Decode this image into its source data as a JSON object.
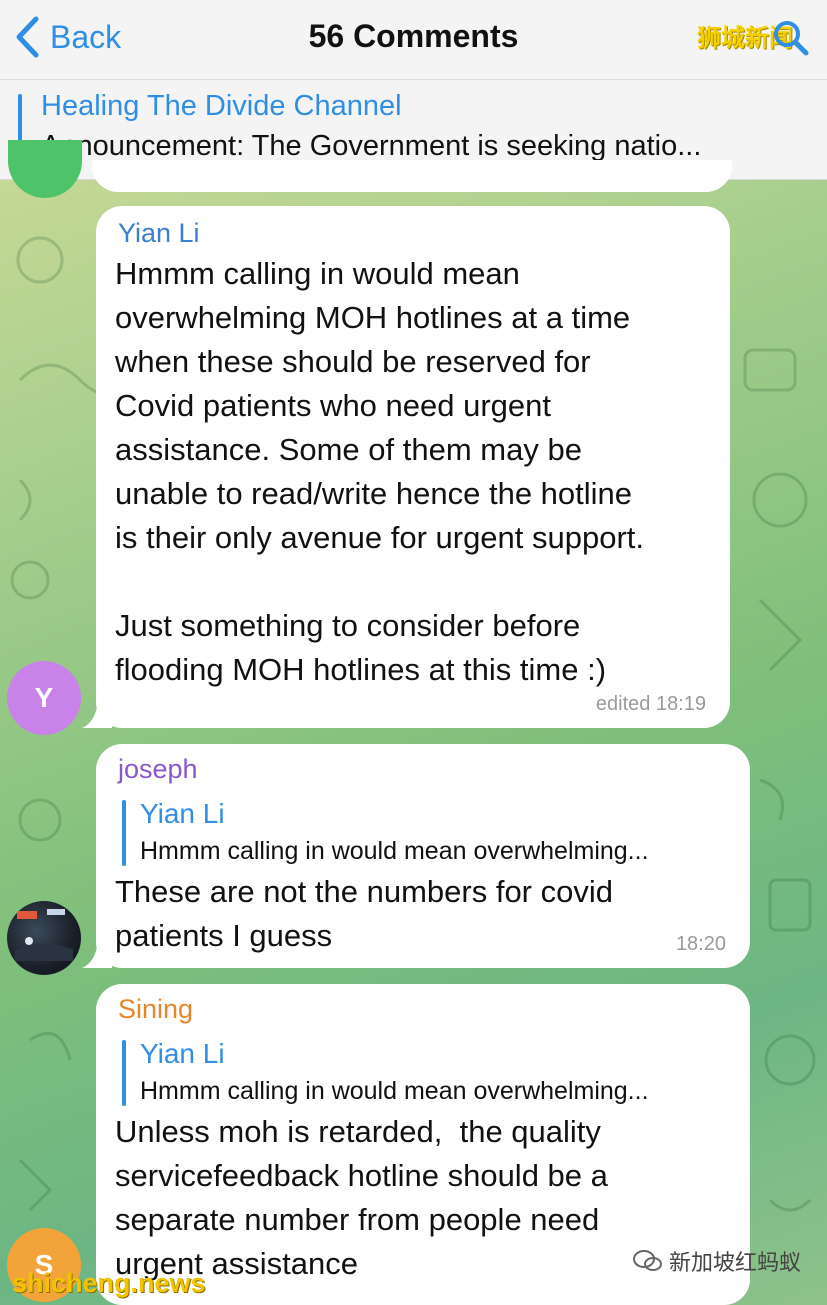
{
  "navbar": {
    "back_label": "Back",
    "title": "56 Comments",
    "watermark": "狮城新闻"
  },
  "pinned": {
    "channel": "Healing The Divide Channel",
    "text": "Announcement:  The Government is seeking natio..."
  },
  "messages": [
    {
      "sender": "Yian Li",
      "sender_color": "#3a7fd0",
      "avatar_letter": "Y",
      "avatar_color": "#c882e8",
      "text": "Hmmm calling in would mean\noverwhelming MOH hotlines at a time\nwhen these should be reserved for\nCovid patients who need urgent\nassistance. Some of them may be\nunable to read/write hence the hotline\nis their only avenue for urgent support.\n\nJust something to consider before\nflooding MOH hotlines at this time :)",
      "time": "edited 18:19"
    },
    {
      "sender": "joseph",
      "sender_color": "#8a57c9",
      "reply_name": "Yian Li",
      "reply_text": "Hmmm calling in would mean overwhelming...",
      "text": "These are not the numbers for covid\npatients I guess",
      "time": "18:20"
    },
    {
      "sender": "Sining",
      "sender_color": "#e8862a",
      "avatar_letter": "S",
      "avatar_color": "#f2a33a",
      "reply_name": "Yian Li",
      "reply_text": "Hmmm calling in would mean overwhelming...",
      "text": "Unless moh is retarded,  the quality\nservicefeedback hotline should be a\nseparate number from people need\nurgent assistance"
    }
  ],
  "watermarks": {
    "bottom_left": "shicheng.news",
    "bottom_right": "新加坡红蚂蚁"
  }
}
